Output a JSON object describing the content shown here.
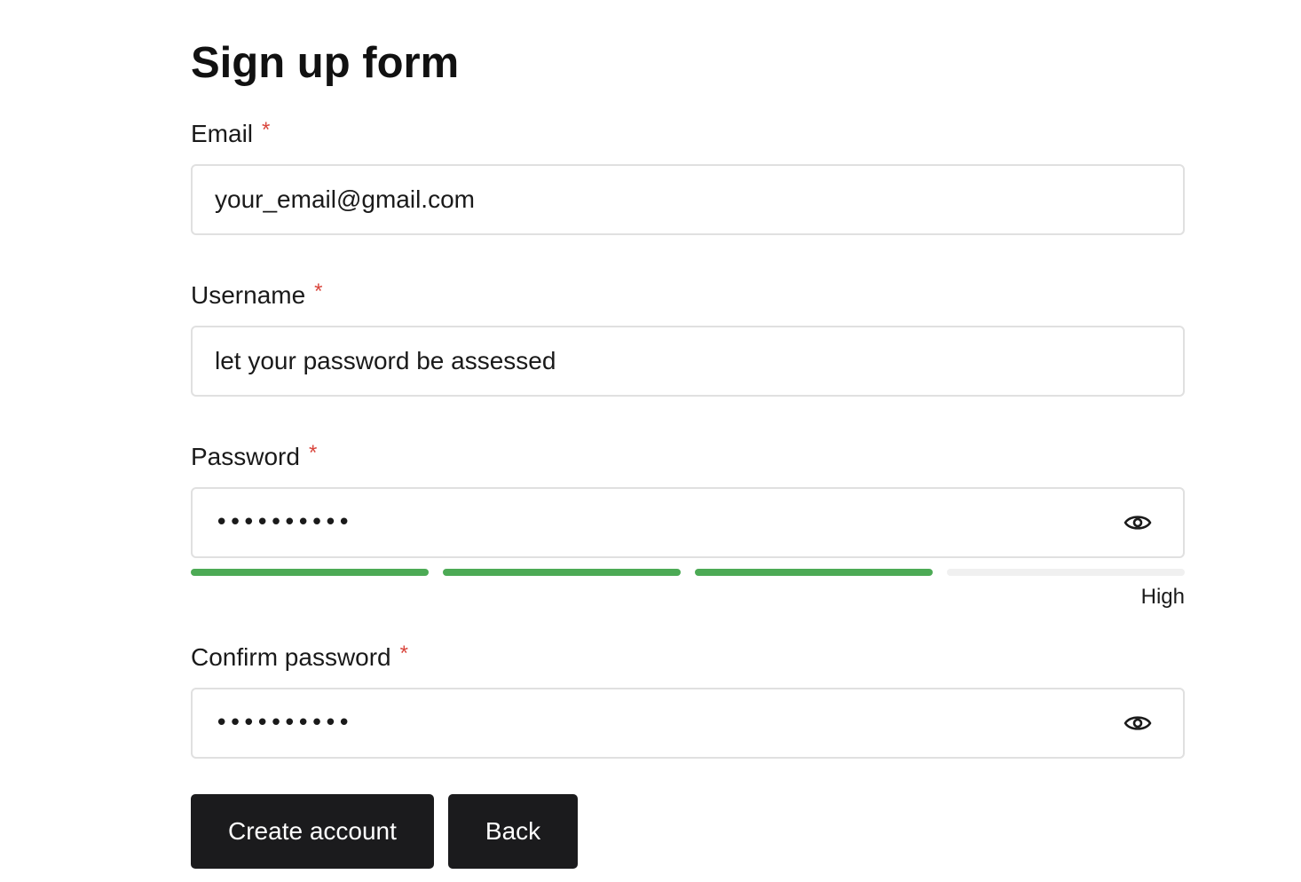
{
  "page": {
    "title": "Sign up form"
  },
  "fields": {
    "email": {
      "label": "Email",
      "required_mark": "*",
      "value": "your_email@gmail.com"
    },
    "username": {
      "label": "Username",
      "required_mark": "*",
      "value": "let your password be assessed"
    },
    "password": {
      "label": "Password",
      "required_mark": "*",
      "masked_value": "••••••••••",
      "toggle_icon": "eye-icon"
    },
    "confirm_password": {
      "label": "Confirm password",
      "required_mark": "*",
      "masked_value": "••••••••••",
      "toggle_icon": "eye-icon"
    }
  },
  "strength_meter": {
    "segments_total": 4,
    "segments_filled": 3,
    "label": "High",
    "filled_color": "#4caa55",
    "empty_color": "#f0f0f0"
  },
  "actions": {
    "create_label": "Create account",
    "back_label": "Back"
  },
  "colors": {
    "required": "#d9453c",
    "button_bg": "#1b1b1d",
    "button_text": "#ffffff",
    "input_border": "#e0e0e0"
  }
}
